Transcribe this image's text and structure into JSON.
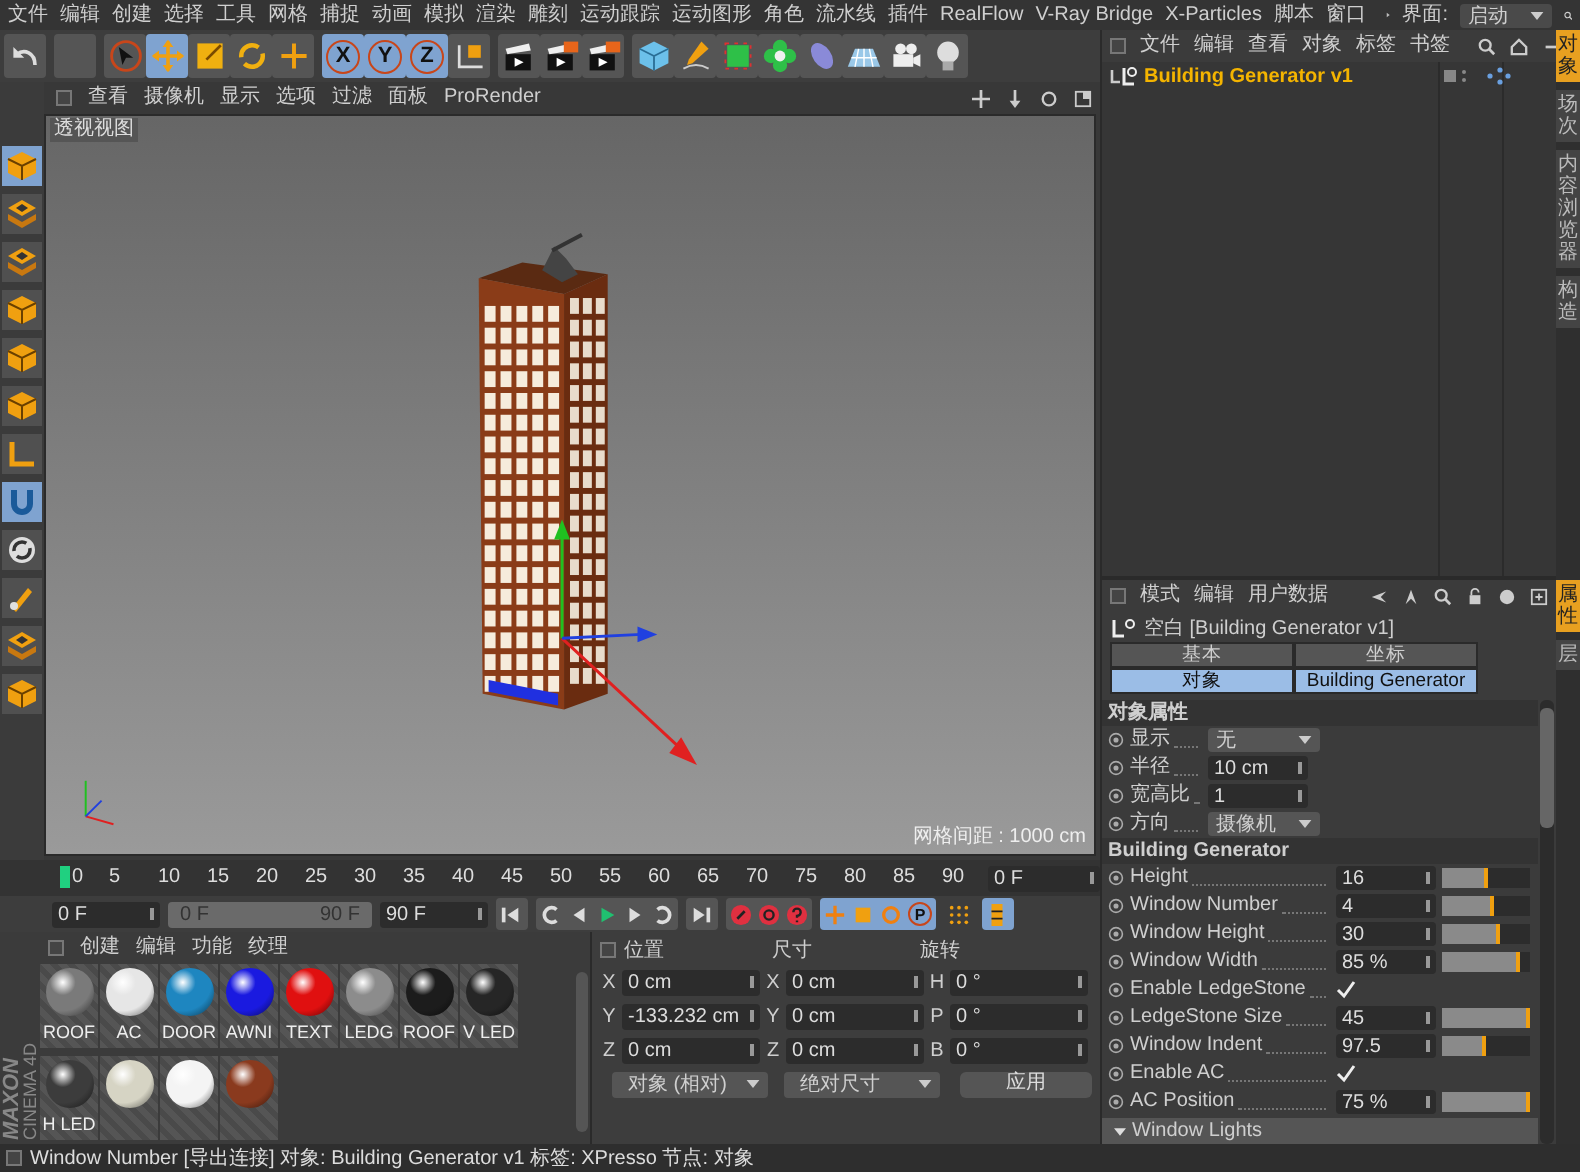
{
  "menu_bar": {
    "items": [
      "文件",
      "编辑",
      "创建",
      "选择",
      "工具",
      "网格",
      "捕捉",
      "动画",
      "模拟",
      "渲染",
      "雕刻",
      "运动跟踪",
      "运动图形",
      "角色",
      "流水线",
      "插件",
      "RealFlow",
      "V-Ray Bridge",
      "X-Particles",
      "脚本",
      "窗口"
    ],
    "layout_label": "界面:",
    "layout_value": "启动"
  },
  "toolbar": {
    "tools": [
      {
        "selected": false
      },
      {
        "selected": true
      },
      {
        "selected": false
      },
      {
        "selected": false
      },
      {
        "selected": false
      }
    ],
    "axes": [
      {
        "label": "X",
        "selected": true
      },
      {
        "label": "Y",
        "selected": true
      },
      {
        "label": "Z",
        "selected": true
      }
    ]
  },
  "left_toolbar": [
    {
      "selected": true
    },
    {
      "selected": false
    },
    {
      "selected": false
    },
    {
      "selected": false
    },
    {
      "selected": false
    },
    {
      "selected": false
    },
    {
      "selected": false
    },
    {
      "selected": true
    },
    {
      "selected": false
    },
    {
      "selected": false
    },
    {
      "selected": false
    },
    {
      "selected": false
    }
  ],
  "viewport": {
    "menu": [
      "查看",
      "摄像机",
      "显示",
      "选项",
      "过滤",
      "面板",
      "ProRender"
    ],
    "camera_label": "透视视图",
    "grid_spacing": "网格间距 : 1000 cm"
  },
  "timeline": {
    "ticks": [
      "0",
      "5",
      "10",
      "15",
      "20",
      "25",
      "30",
      "35",
      "40",
      "45",
      "50",
      "55",
      "60",
      "65",
      "70",
      "75",
      "80",
      "85",
      "90"
    ],
    "current_frame": "0 F"
  },
  "transport": {
    "start": "0 F",
    "range": {
      "start": "0 F",
      "end": "90 F",
      "level": 1
    },
    "end": "90 F",
    "param_key_label": "P"
  },
  "materials": {
    "menu": [
      "创建",
      "编辑",
      "功能",
      "纹理"
    ],
    "items": [
      {
        "name": "ROOF",
        "color": "#7a7a7a"
      },
      {
        "name": "AC",
        "color": "#e6e6e6"
      },
      {
        "name": "DOOR",
        "color": "#1e86c0"
      },
      {
        "name": "AWNI",
        "color": "#1a1ae0"
      },
      {
        "name": "TEXT",
        "color": "#e01010"
      },
      {
        "name": "LEDG",
        "color": "#8c8c8c"
      },
      {
        "name": "ROOF",
        "color": "#1c1c1c"
      },
      {
        "name": "V LED",
        "color": "#262626"
      },
      {
        "name": "H LED",
        "color": "#3c3c3c"
      },
      {
        "color": "#d6d4c4"
      },
      {
        "color": "#f4f4f4"
      },
      {
        "color": "#8a3a1e"
      }
    ]
  },
  "logo": {
    "brand": "MAXON",
    "product": "CINEMA 4D"
  },
  "coordinates": {
    "headers": [
      "位置",
      "尺寸",
      "旋转"
    ],
    "rows": [
      {
        "p_axis": "X",
        "position": "0 cm",
        "s_axis": "X",
        "size": "0 cm",
        "r_axis": "H",
        "rotation": "0 °"
      },
      {
        "p_axis": "Y",
        "position": "-133.232 cm",
        "s_axis": "Y",
        "size": "0 cm",
        "r_axis": "P",
        "rotation": "0 °"
      },
      {
        "p_axis": "Z",
        "position": "0 cm",
        "s_axis": "Z",
        "size": "0 cm",
        "r_axis": "B",
        "rotation": "0 °"
      }
    ],
    "mode": "对象 (相对)",
    "size_mode": "绝对尺寸",
    "apply": "应用"
  },
  "object_manager": {
    "menu": [
      "文件",
      "编辑",
      "查看",
      "对象",
      "标签",
      "书签"
    ],
    "objects": [
      {
        "name": "Building Generator v1",
        "selected": true
      }
    ]
  },
  "attributes": {
    "menu": [
      "模式",
      "编辑",
      "用户数据"
    ],
    "title": "空白 [Building Generator v1]",
    "tabs": [
      {
        "label": "基本",
        "selected": false
      },
      {
        "label": "坐标",
        "selected": false
      },
      {
        "label": "对象",
        "selected": true
      },
      {
        "label": "Building Generator",
        "selected": true
      }
    ],
    "sections": [
      {
        "title": "对象属性",
        "props": [
          {
            "kind": "dropdown",
            "label": "显示",
            "value": "无"
          },
          {
            "kind": "number",
            "label": "半径",
            "value": "10 cm"
          },
          {
            "kind": "number",
            "label": "宽高比",
            "value": "1"
          },
          {
            "kind": "dropdown",
            "label": "方向",
            "value": "摄像机"
          }
        ]
      },
      {
        "title": "Building Generator",
        "props": [
          {
            "kind": "slider",
            "label": "Height",
            "value": "16",
            "level": 0.52
          },
          {
            "kind": "slider",
            "label": "Window Number",
            "value": "4",
            "level": 0.6
          },
          {
            "kind": "slider",
            "label": "Window Height",
            "value": "30",
            "level": 0.67
          },
          {
            "kind": "slider",
            "label": "Window Width",
            "value": "85 %",
            "level": 0.88
          },
          {
            "kind": "checkbox",
            "label": "Enable LedgeStone",
            "checked": true
          },
          {
            "kind": "slider",
            "label": "LedgeStone Size",
            "value": "45",
            "level": 1
          },
          {
            "kind": "slider",
            "label": "Window Indent",
            "value": "97.5",
            "level": 0.51
          },
          {
            "kind": "checkbox",
            "label": "Enable AC",
            "checked": true
          },
          {
            "kind": "slider",
            "label": "AC Position",
            "value": "75 %",
            "level": 1
          }
        ]
      }
    ],
    "group": "Window Lights"
  },
  "side_tabs": {
    "top": [
      {
        "label": "对象",
        "selected": true
      },
      {
        "label": "场次",
        "selected": false
      },
      {
        "label": "内容浏览器",
        "selected": false
      },
      {
        "label": "构造",
        "selected": false
      }
    ],
    "bottom": [
      {
        "label": "属性",
        "selected": true
      },
      {
        "label": "层",
        "selected": false
      }
    ]
  },
  "status_bar": "Window Number [导出连接] 对象: Building Generator v1  标签: XPresso  节点: 对象"
}
